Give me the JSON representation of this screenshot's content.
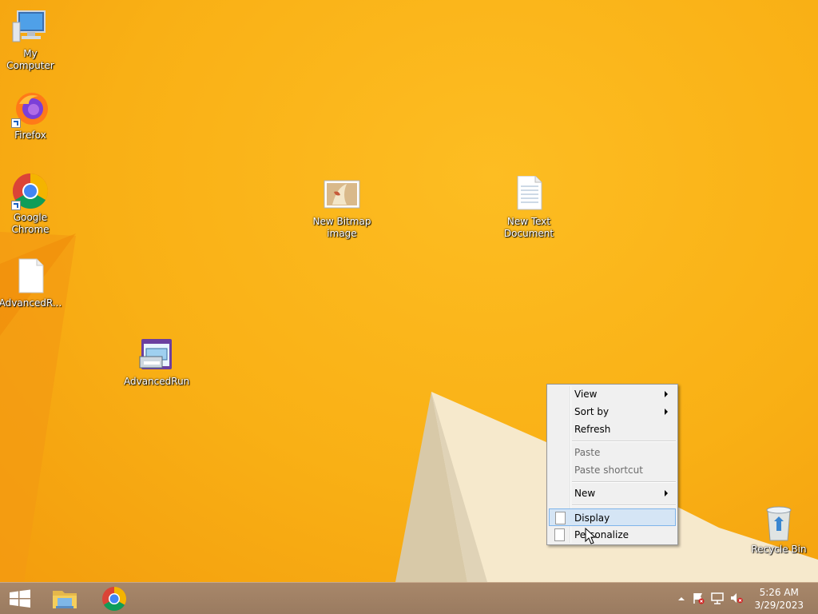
{
  "desktop": {
    "icons": {
      "my_computer": "My Computer",
      "firefox": "Firefox",
      "chrome": "Google Chrome",
      "advancedrun_file": "AdvancedR...",
      "advancedrun_app": "AdvancedRun",
      "bitmap": "New Bitmap image",
      "text_doc": "New Text Document",
      "recycle_bin": "Recycle Bin"
    }
  },
  "context_menu": {
    "items": [
      {
        "label": "View",
        "submenu": true,
        "enabled": true
      },
      {
        "label": "Sort by",
        "submenu": true,
        "enabled": true
      },
      {
        "label": "Refresh",
        "submenu": false,
        "enabled": true
      },
      {
        "label": "Paste",
        "submenu": false,
        "enabled": false
      },
      {
        "label": "Paste shortcut",
        "submenu": false,
        "enabled": false
      },
      {
        "label": "New",
        "submenu": true,
        "enabled": true
      },
      {
        "label": "Display",
        "submenu": false,
        "enabled": true,
        "highlighted": true
      },
      {
        "label": "Personalize",
        "submenu": false,
        "enabled": true
      }
    ]
  },
  "taskbar": {
    "pinned": [
      "file-explorer-icon",
      "chrome-icon"
    ],
    "tray_icons": [
      "show-hidden-icons-chevron",
      "action-center-flag-icon",
      "network-icon",
      "volume-muted-icon"
    ],
    "clock": {
      "time": "5:26 AM",
      "date": "3/29/2023"
    }
  },
  "colors": {
    "wallpaper": "#f9b015",
    "taskbar": "#a38266",
    "menu_highlight": "#d5e5f5"
  }
}
